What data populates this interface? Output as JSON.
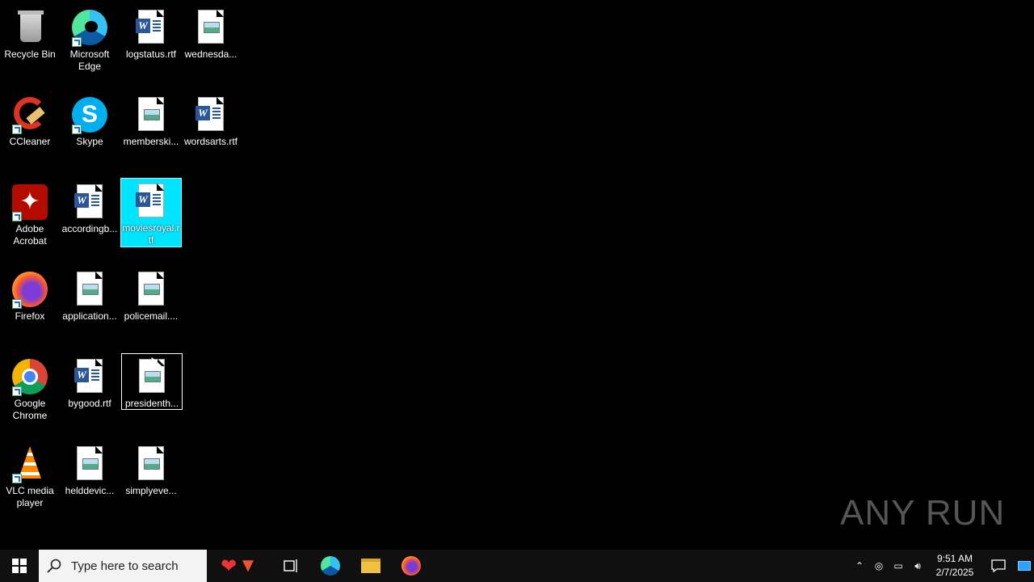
{
  "desktop": {
    "icons": [
      {
        "label": "Recycle Bin"
      },
      {
        "label": "Microsoft Edge"
      },
      {
        "label": "logstatus.rtf"
      },
      {
        "label": "wednesda..."
      },
      {
        "label": "CCleaner"
      },
      {
        "label": "Skype"
      },
      {
        "label": "memberski..."
      },
      {
        "label": "wordsarts.rtf"
      },
      {
        "label": "Adobe Acrobat"
      },
      {
        "label": "accordingb..."
      },
      {
        "label": "moviesroyal.rtf"
      },
      {
        "label": "Firefox"
      },
      {
        "label": "application..."
      },
      {
        "label": "policemail...."
      },
      {
        "label": "Google Chrome"
      },
      {
        "label": "bygood.rtf"
      },
      {
        "label": "presidenth..."
      },
      {
        "label": "VLC media player"
      },
      {
        "label": "helddevic..."
      },
      {
        "label": "simplyeve..."
      }
    ]
  },
  "taskbar": {
    "search_placeholder": "Type here to search",
    "time": "9:51 AM",
    "date": "2/7/2025"
  },
  "watermark": "ANY RUN",
  "colors": {
    "selection": "#00e5ff",
    "taskbar": "#101010",
    "search_bg": "#f3f3f3"
  }
}
